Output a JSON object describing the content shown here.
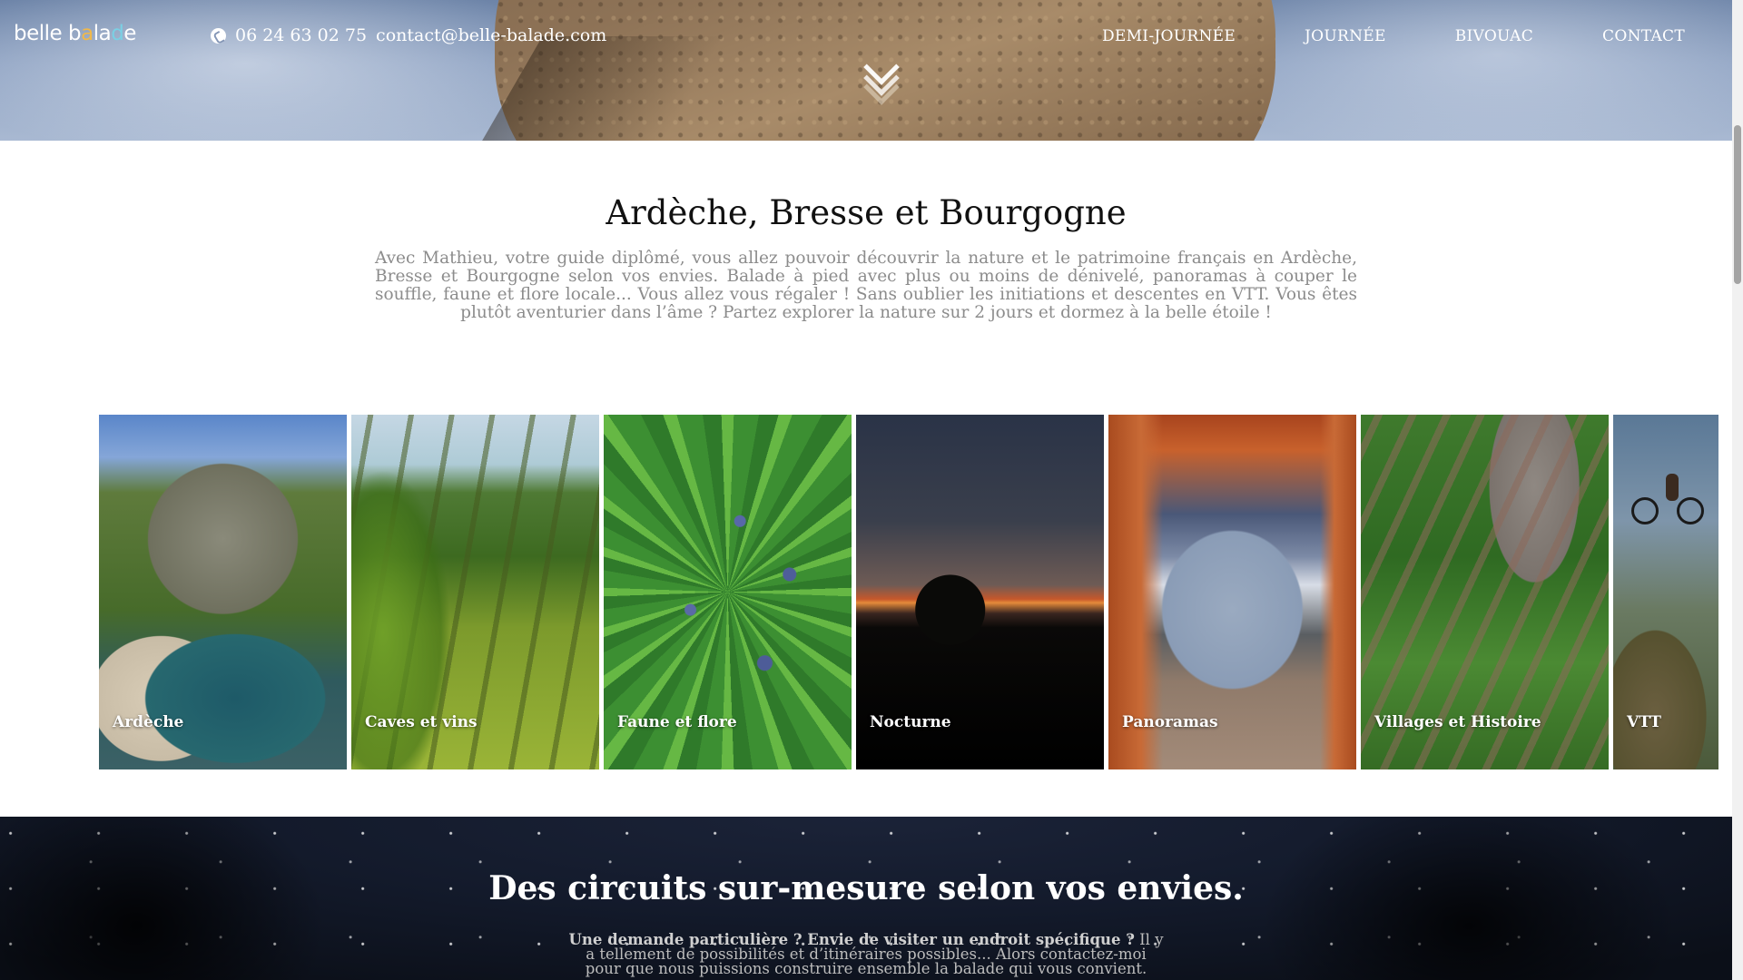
{
  "header": {
    "logo": {
      "part1": "belle b",
      "dot_a": "a",
      "part2": "la",
      "dot_b": "d",
      "part3": "e"
    },
    "phone": "06 24 63 02 75",
    "email": "contact@belle-balade.com",
    "nav": [
      "DEMI-JOURNÉE",
      "JOURNÉE",
      "BIVOUAC",
      "CONTACT"
    ]
  },
  "intro": {
    "title": "Ardèche, Bresse et Bourgogne",
    "text": "Avec Mathieu, votre guide diplômé, vous allez pouvoir découvrir la nature et le patrimoine français en Ardèche, Bresse et Bourgogne selon vos envies. Balade à pied avec plus ou moins de dénivelé, panoramas à couper le souffle, faune et flore locale... Vous allez vous régaler ! Sans oublier les initiations et descentes en VTT. Vous êtes plutôt aventurier dans l’âme ? Partez explorer la nature sur 2 jours et dormez à la belle étoile !"
  },
  "gallery": [
    {
      "label": "Ardèche"
    },
    {
      "label": "Caves et vins"
    },
    {
      "label": "Faune et flore"
    },
    {
      "label": "Nocturne"
    },
    {
      "label": "Panoramas"
    },
    {
      "label": "Villages et Histoire"
    },
    {
      "label": "VTT"
    }
  ],
  "custom": {
    "title": "Des circuits sur-mesure selon vos envies.",
    "lead_bold": "Une demande particulière ? Envie de visiter un endroit spécifique ?",
    "text": " Il y a tellement de possibilités et d’itinéraires possibles... Alors contactez-moi pour que nous puissions construire ensemble la balade qui vous convient."
  },
  "colors": {
    "text_dark": "#111111",
    "text_muted": "#8c8c8c",
    "night_bg": "#131a2b",
    "logo_accent_a": "#f0b84a",
    "logo_accent_b": "#7ad0e4"
  },
  "icons": {
    "phone": "phone-icon",
    "scroll": "chevron-down-icon"
  }
}
